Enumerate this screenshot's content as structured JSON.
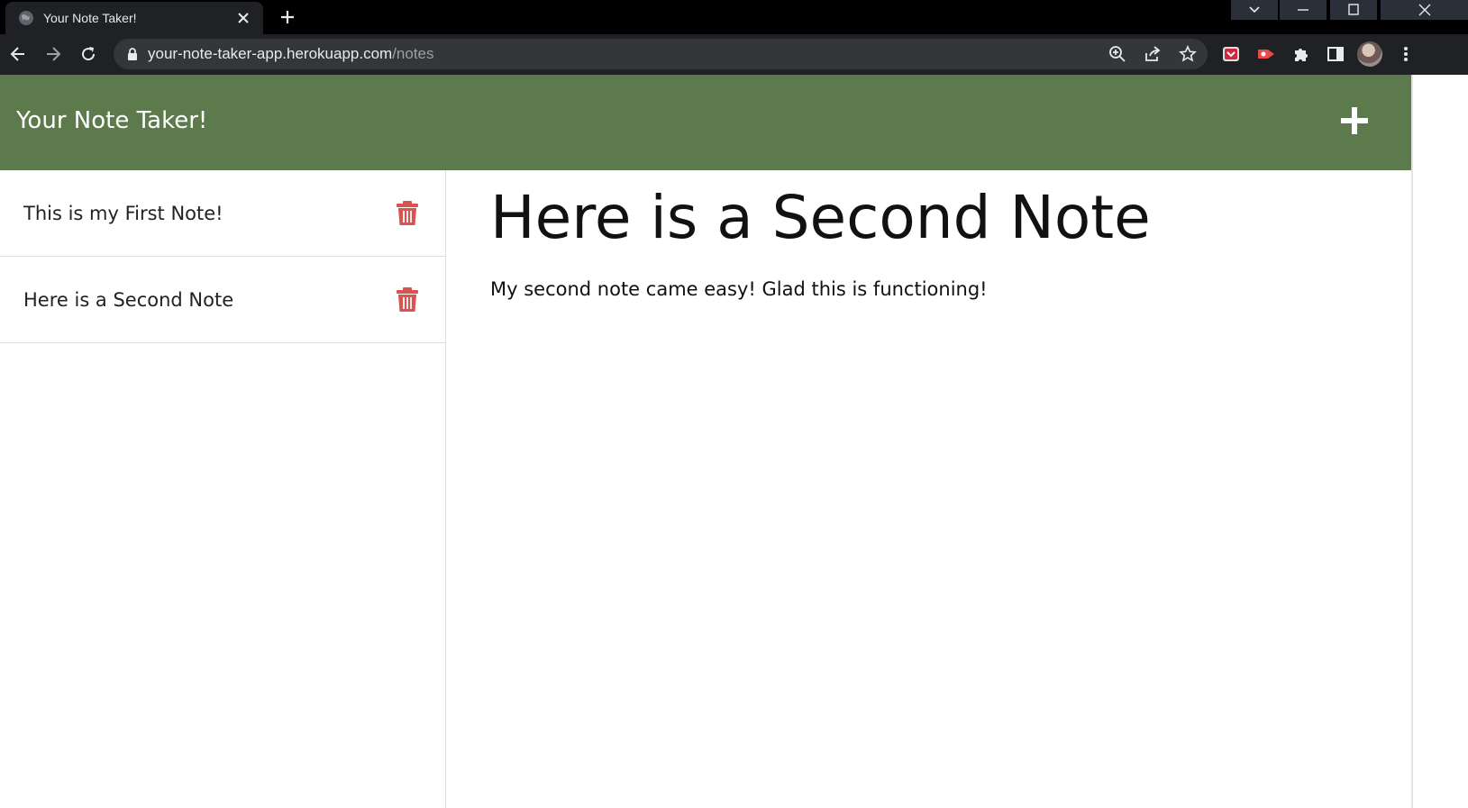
{
  "browser": {
    "tab_title": "Your Note Taker!",
    "url_host": "your-note-taker-app.herokuapp.com",
    "url_path": "/notes"
  },
  "app": {
    "title": "Your Note Taker!",
    "header_color": "#5c7a4b",
    "delete_color": "#d9534f"
  },
  "notes": [
    {
      "title": "This is my First Note!"
    },
    {
      "title": "Here is a Second Note"
    }
  ],
  "active_note": {
    "title": "Here is a Second Note",
    "text": "My second note came easy! Glad this is functioning!"
  },
  "icons": {
    "favicon": "globe-icon",
    "tab_close": "close-icon",
    "new_tab": "plus-icon",
    "back": "arrow-left-icon",
    "forward": "arrow-right-icon",
    "reload": "reload-icon",
    "lock": "lock-icon",
    "zoom": "zoom-icon",
    "share": "share-icon",
    "bookmark": "star-icon",
    "add_note": "plus-icon",
    "delete_note": "trash-icon"
  }
}
